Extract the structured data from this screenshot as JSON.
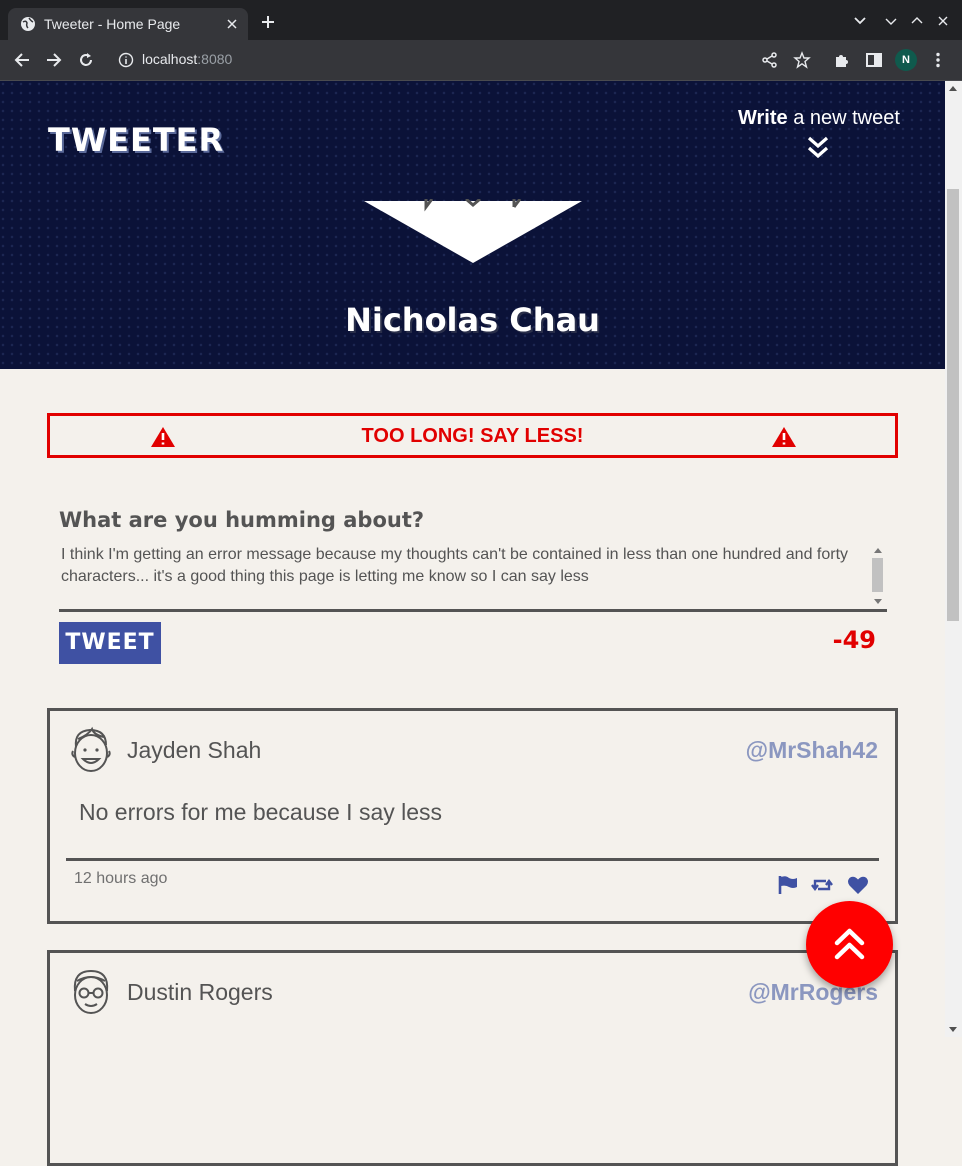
{
  "browser": {
    "tab_title": "Tweeter - Home Page",
    "url_host": "localhost",
    "url_port": ":8080",
    "profile_initial": "N"
  },
  "header": {
    "brand": "TWEETER",
    "write_bold": "Write",
    "write_rest": " a new tweet",
    "user_name": "Nicholas Chau"
  },
  "error": {
    "message": "TOO LONG! SAY LESS!"
  },
  "compose": {
    "label": "What are you humming about?",
    "text": "I think I'm getting an error message because my thoughts can't be contained in less than one hundred and forty characters... it's a good thing this page is letting me know so I can say less",
    "button_label": "TWEET",
    "counter": "-49"
  },
  "tweets": [
    {
      "name": "Jayden Shah",
      "handle": "@MrShah42",
      "content": "No errors for me because I say less",
      "time": "12 hours ago"
    },
    {
      "name": "Dustin Rogers",
      "handle": "@MrRogers"
    }
  ],
  "colors": {
    "accent": "#3f51a3",
    "error": "#e10000",
    "header_bg": "#0b1238",
    "page_bg": "#f4f1ec"
  },
  "icons": [
    "warning-icon",
    "flag-icon",
    "retweet-icon",
    "heart-icon",
    "double-chevron-up-icon",
    "double-chevron-down-icon"
  ]
}
